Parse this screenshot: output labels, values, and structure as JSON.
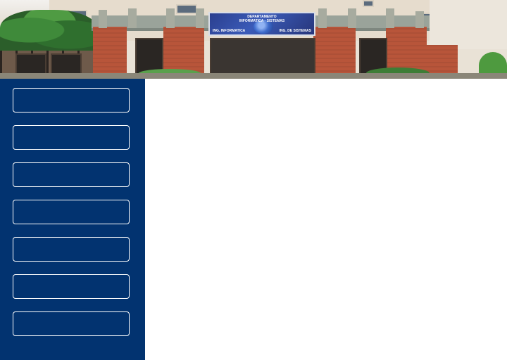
{
  "header": {
    "image": "department-building-photo",
    "banner": {
      "line1": "DEPARTAMENTO",
      "line2": "INFORMATICA · SISTEMAS",
      "left_caption": "ING. INFORMATICA",
      "right_caption": "ING. DE SISTEMAS"
    }
  },
  "sidebar": {
    "background_color": "#023370",
    "items": [
      {
        "label": ""
      },
      {
        "label": ""
      },
      {
        "label": ""
      },
      {
        "label": ""
      },
      {
        "label": ""
      },
      {
        "label": ""
      },
      {
        "label": ""
      }
    ]
  },
  "main": {
    "background_color": "#ffffff"
  }
}
